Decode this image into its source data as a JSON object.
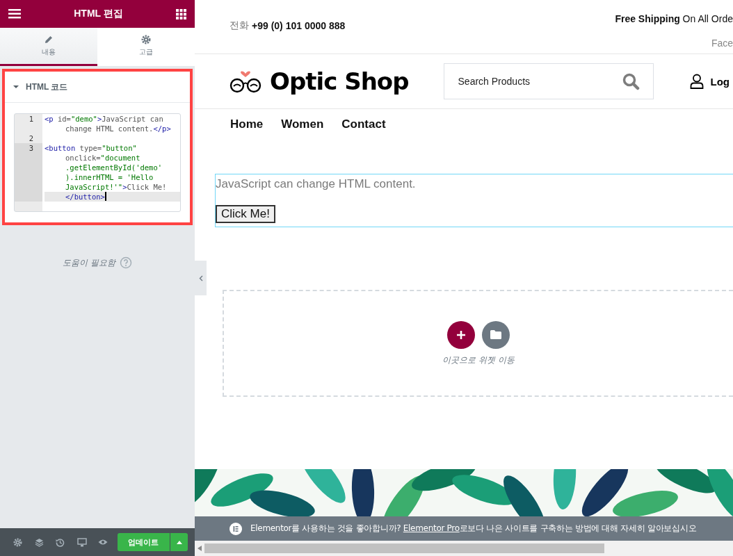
{
  "panel": {
    "title": "HTML 편집",
    "tabs": [
      {
        "kind": "content",
        "label": "내용",
        "selected": true
      },
      {
        "kind": "advanced",
        "label": "고급",
        "selected": false
      }
    ],
    "section": {
      "title": "HTML 코드",
      "expanded": true,
      "highlighted": true,
      "code_lines": [
        {
          "number": "1",
          "active": false,
          "rows": [
            {
              "tokens": [
                {
                  "kind": "tag",
                  "text": "<p"
                },
                {
                  "kind": "attr",
                  "text": " id="
                },
                {
                  "kind": "string",
                  "text": "\"demo\""
                },
                {
                  "kind": "tag",
                  "text": ">"
                },
                {
                  "kind": "text",
                  "text": "JavaScript can"
                }
              ]
            },
            {
              "tokens": [
                {
                  "kind": "text",
                  "text": "change HTML content."
                },
                {
                  "kind": "tag",
                  "text": "</p>"
                }
              ]
            }
          ]
        },
        {
          "number": "2",
          "active": false
        },
        {
          "number": "3",
          "active": true,
          "rows": [
            {
              "tokens": [
                {
                  "kind": "tag",
                  "text": "<button"
                },
                {
                  "kind": "attr",
                  "text": " type="
                },
                {
                  "kind": "string",
                  "text": "\"button\""
                }
              ]
            },
            {
              "tokens": [
                {
                  "kind": "attr",
                  "text": "onclick="
                },
                {
                  "kind": "string",
                  "text": "\"document"
                }
              ]
            },
            {
              "tokens": [
                {
                  "kind": "string",
                  "text": ".getElementById('demo'"
                }
              ]
            },
            {
              "tokens": [
                {
                  "kind": "string",
                  "text": ").innerHTML = 'Hello"
                }
              ]
            },
            {
              "tokens": [
                {
                  "kind": "string",
                  "text": "JavaScript!'\""
                },
                {
                  "kind": "tag",
                  "text": ">"
                },
                {
                  "kind": "text",
                  "text": "Click Me!"
                }
              ]
            },
            {
              "tokens": [
                {
                  "kind": "tag",
                  "text": "</button>"
                }
              ]
            }
          ]
        }
      ]
    },
    "help": "도움이 필요함",
    "update_button": "업데이트"
  },
  "preview": {
    "phone_label": "전화",
    "phone": "+99 (0) 101 0000 888",
    "shipping": "**Free Shipping** On All Orde",
    "social": "Face",
    "logo": "Optic Shop",
    "search_placeholder": "Search Products",
    "login": "Log",
    "nav": [
      {
        "label": "Home"
      },
      {
        "label": "Women"
      },
      {
        "label": "Contact"
      }
    ],
    "widget": {
      "paragraph": "JavaScript can change HTML content.",
      "button": "Click Me!"
    },
    "drop_zone": "이곳으로 위젯 이동",
    "notice": {
      "text": "Elementor를 사용하는 것을 좋아합니까?",
      "link": "Elementor Pro",
      "rest": "로보다 나은 사이트를 구축하는 방법에 대해 자세히 알아보십시오"
    }
  }
}
